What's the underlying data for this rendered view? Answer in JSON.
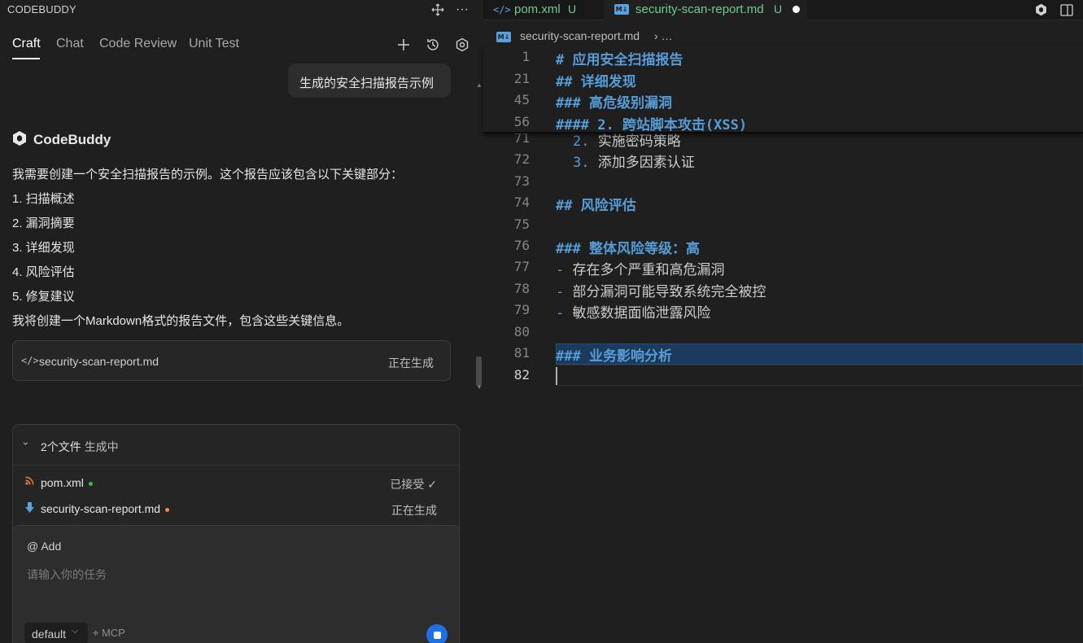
{
  "sidebar": {
    "app_title": "CODEBUDDY",
    "tabs": [
      "Craft",
      "Chat",
      "Code Review",
      "Unit Test"
    ],
    "active_tab": "Craft",
    "user_bubble": "生成的安全扫描报告示例",
    "assistant_name": "CodeBuddy",
    "message_lines": [
      "我需要创建一个安全扫描报告的示例。这个报告应该包含以下关键部分：",
      "1. 扫描概述",
      "2. 漏洞摘要",
      "3. 详细发现",
      "4. 风险评估",
      "5. 修复建议",
      "我将创建一个Markdown格式的报告文件，包含这些关键信息。"
    ],
    "file_card": {
      "name": "security-scan-report.md",
      "status": "正在生成"
    },
    "gen_panel": {
      "title_count": "2个文件",
      "title_status": "生成中",
      "files": [
        {
          "name": "pom.xml",
          "status": "已接受",
          "dot_color": "#3fb950"
        },
        {
          "name": "security-scan-report.md",
          "status": "正在生成",
          "dot_color": "#f0883e"
        }
      ]
    },
    "input": {
      "add_label": "@ Add",
      "placeholder": "请输入你的任务",
      "model": "default",
      "mcp_label": "MCP"
    }
  },
  "editor": {
    "tabs": [
      {
        "name": "pom.xml",
        "status": "U"
      },
      {
        "name": "security-scan-report.md",
        "status": "U",
        "dirty": true
      }
    ],
    "breadcrumb": {
      "file": "security-scan-report.md",
      "rest": "› …"
    },
    "sticky_lines": [
      {
        "num": "1",
        "hash": "#",
        "text": "应用安全扫描报告"
      },
      {
        "num": "21",
        "hash": "##",
        "text": "详细发现"
      },
      {
        "num": "45",
        "hash": "###",
        "text": "高危级别漏洞"
      },
      {
        "num": "56",
        "hash": "####",
        "text": "2. 跨站脚本攻击(XSS)"
      }
    ],
    "lines": [
      {
        "num": "71",
        "kind": "ol",
        "marker": "2.",
        "text": "实施密码策略"
      },
      {
        "num": "72",
        "kind": "ol",
        "marker": "3.",
        "text": "添加多因素认证"
      },
      {
        "num": "73",
        "kind": "blank",
        "marker": "",
        "text": ""
      },
      {
        "num": "74",
        "kind": "head",
        "marker": "##",
        "text": "风险评估"
      },
      {
        "num": "75",
        "kind": "blank",
        "marker": "",
        "text": ""
      },
      {
        "num": "76",
        "kind": "head",
        "marker": "###",
        "text": "整体风险等级：高"
      },
      {
        "num": "77",
        "kind": "li",
        "marker": "-",
        "text": "存在多个严重和高危漏洞"
      },
      {
        "num": "78",
        "kind": "li",
        "marker": "-",
        "text": "部分漏洞可能导致系统完全被控"
      },
      {
        "num": "79",
        "kind": "li",
        "marker": "-",
        "text": "敏感数据面临泄露风险"
      },
      {
        "num": "80",
        "kind": "blank",
        "marker": "",
        "text": ""
      },
      {
        "num": "81",
        "kind": "head",
        "marker": "###",
        "text": "业务影响分析"
      },
      {
        "num": "82",
        "kind": "blank",
        "marker": "",
        "text": ""
      }
    ]
  },
  "colors": {
    "accent": "#1f6feb",
    "heading": "#569cd6",
    "untracked": "#73c991"
  }
}
